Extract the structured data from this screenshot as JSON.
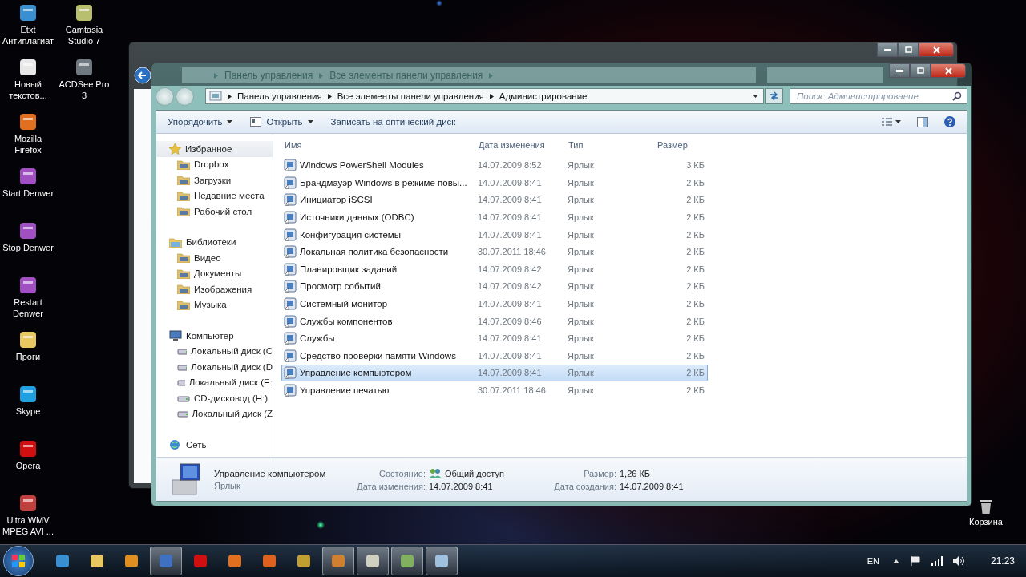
{
  "desktop": {
    "icons": [
      {
        "label": "Etxt Антиплагиат"
      },
      {
        "label": "Новый текстов..."
      },
      {
        "label": "Mozilla Firefox"
      },
      {
        "label": "Start Denwer"
      },
      {
        "label": "Stop Denwer"
      },
      {
        "label": "Restart Denwer"
      },
      {
        "label": "Проги"
      },
      {
        "label": "Skype"
      },
      {
        "label": "Opera"
      },
      {
        "label": "Ultra WMV MPEG AVI ..."
      },
      {
        "label": "Camtasia Studio 7"
      },
      {
        "label": "ACDSee Pro 3"
      }
    ],
    "recycle_bin": {
      "label": "Корзина"
    }
  },
  "back_window": {
    "breadcrumb": [
      "Панель управления",
      "Все элементы панели управления"
    ]
  },
  "window": {
    "breadcrumb": [
      "Панель управления",
      "Все элементы панели управления",
      "Администрирование"
    ],
    "search": {
      "placeholder": "Поиск: Администрирование"
    },
    "toolbar": [
      {
        "label": "Упорядочить",
        "dropdown": true
      },
      {
        "label": "Открыть",
        "dropdown": true
      },
      {
        "label": "Записать на оптический диск",
        "dropdown": false
      }
    ],
    "sidebar": [
      {
        "label": "Избранное",
        "selected": true,
        "children": [
          {
            "label": "Dropbox",
            "selected": false
          },
          {
            "label": "Загрузки",
            "selected": false
          },
          {
            "label": "Недавние места",
            "selected": false
          },
          {
            "label": "Рабочий стол",
            "selected": false
          }
        ]
      },
      {
        "label": "Библиотеки",
        "selected": false,
        "children": [
          {
            "label": "Видео",
            "selected": false
          },
          {
            "label": "Документы",
            "selected": false
          },
          {
            "label": "Изображения",
            "selected": false
          },
          {
            "label": "Музыка",
            "selected": false
          }
        ]
      },
      {
        "label": "Компьютер",
        "selected": false,
        "children": [
          {
            "label": "Локальный диск (C",
            "selected": false
          },
          {
            "label": "Локальный диск (D",
            "selected": false
          },
          {
            "label": "Локальный диск (E:",
            "selected": false
          },
          {
            "label": "CD-дисковод (H:)",
            "selected": false
          },
          {
            "label": "Локальный диск (Z",
            "selected": false
          }
        ]
      },
      {
        "label": "Сеть",
        "selected": false
      }
    ],
    "table": {
      "columns": [
        "Имя",
        "Дата изменения",
        "Тип",
        "Размер"
      ],
      "rows": [
        {
          "name": "Windows PowerShell Modules",
          "date": "14.07.2009 8:52",
          "type": "Ярлык",
          "size": "3 КБ",
          "selected": false
        },
        {
          "name": "Брандмауэр Windows в режиме повы...",
          "date": "14.07.2009 8:41",
          "type": "Ярлык",
          "size": "2 КБ",
          "selected": false
        },
        {
          "name": "Инициатор iSCSI",
          "date": "14.07.2009 8:41",
          "type": "Ярлык",
          "size": "2 КБ",
          "selected": false
        },
        {
          "name": "Источники данных (ODBC)",
          "date": "14.07.2009 8:41",
          "type": "Ярлык",
          "size": "2 КБ",
          "selected": false
        },
        {
          "name": "Конфигурация системы",
          "date": "14.07.2009 8:41",
          "type": "Ярлык",
          "size": "2 КБ",
          "selected": false
        },
        {
          "name": "Локальная политика безопасности",
          "date": "30.07.2011 18:46",
          "type": "Ярлык",
          "size": "2 КБ",
          "selected": false
        },
        {
          "name": "Планировщик заданий",
          "date": "14.07.2009 8:42",
          "type": "Ярлык",
          "size": "2 КБ",
          "selected": false
        },
        {
          "name": "Просмотр событий",
          "date": "14.07.2009 8:42",
          "type": "Ярлык",
          "size": "2 КБ",
          "selected": false
        },
        {
          "name": "Системный монитор",
          "date": "14.07.2009 8:41",
          "type": "Ярлык",
          "size": "2 КБ",
          "selected": false
        },
        {
          "name": "Службы компонентов",
          "date": "14.07.2009 8:46",
          "type": "Ярлык",
          "size": "2 КБ",
          "selected": false
        },
        {
          "name": "Службы",
          "date": "14.07.2009 8:41",
          "type": "Ярлык",
          "size": "2 КБ",
          "selected": false
        },
        {
          "name": "Средство проверки памяти Windows",
          "date": "14.07.2009 8:41",
          "type": "Ярлык",
          "size": "2 КБ",
          "selected": false
        },
        {
          "name": "Управление компьютером",
          "date": "14.07.2009 8:41",
          "type": "Ярлык",
          "size": "2 КБ",
          "selected": true
        },
        {
          "name": "Управление печатью",
          "date": "30.07.2011 18:46",
          "type": "Ярлык",
          "size": "2 КБ",
          "selected": false
        }
      ]
    },
    "details": {
      "name": "Управление компьютером",
      "type": "Ярлык",
      "fields": [
        {
          "label": "Состояние:",
          "value": "Общий доступ"
        },
        {
          "label": "Размер:",
          "value": "1,26 КБ"
        },
        {
          "label": "Дата изменения:",
          "value": "14.07.2009 8:41"
        },
        {
          "label": "Дата создания:",
          "value": "14.07.2009 8:41"
        }
      ]
    }
  },
  "taskbar": {
    "buttons": [
      {
        "open": false
      },
      {
        "open": false
      },
      {
        "open": false
      },
      {
        "open": true
      },
      {
        "open": false
      },
      {
        "open": false
      },
      {
        "open": false
      },
      {
        "open": false
      },
      {
        "open": true
      },
      {
        "open": true
      },
      {
        "open": true
      },
      {
        "open": true
      }
    ],
    "language": "EN",
    "clock": "21:23"
  }
}
